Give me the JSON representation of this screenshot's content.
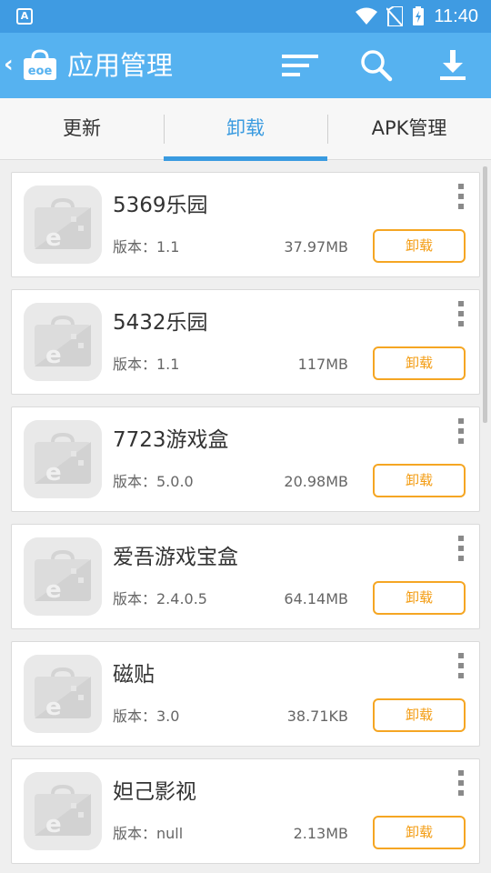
{
  "status_bar": {
    "app_badge": "A",
    "time": "11:40"
  },
  "appbar": {
    "title": "应用管理",
    "back_label": "‹"
  },
  "tabs": [
    {
      "label": "更新"
    },
    {
      "label": "卸载"
    },
    {
      "label": "APK管理"
    }
  ],
  "version_prefix": "版本：",
  "apps": [
    {
      "name": "5369乐园",
      "version": "版本：1.1",
      "size": "37.97MB",
      "action": "卸载"
    },
    {
      "name": "5432乐园",
      "version": "版本：1.1",
      "size": "117MB",
      "action": "卸载"
    },
    {
      "name": "7723游戏盒",
      "version": "版本：5.0.0",
      "size": "20.98MB",
      "action": "卸载"
    },
    {
      "name": "爱吾游戏宝盒",
      "version": "版本：2.4.0.5",
      "size": "64.14MB",
      "action": "卸载"
    },
    {
      "name": "磁贴",
      "version": "版本：3.0",
      "size": "38.71KB",
      "action": "卸载"
    },
    {
      "name": "妲己影视",
      "version": "版本：null",
      "size": "2.13MB",
      "action": "卸载"
    }
  ],
  "colors": {
    "appbar": "#56b2f0",
    "statusbar": "#3f9be2",
    "accent": "#3a9be0",
    "uninstall": "#f5a623"
  }
}
